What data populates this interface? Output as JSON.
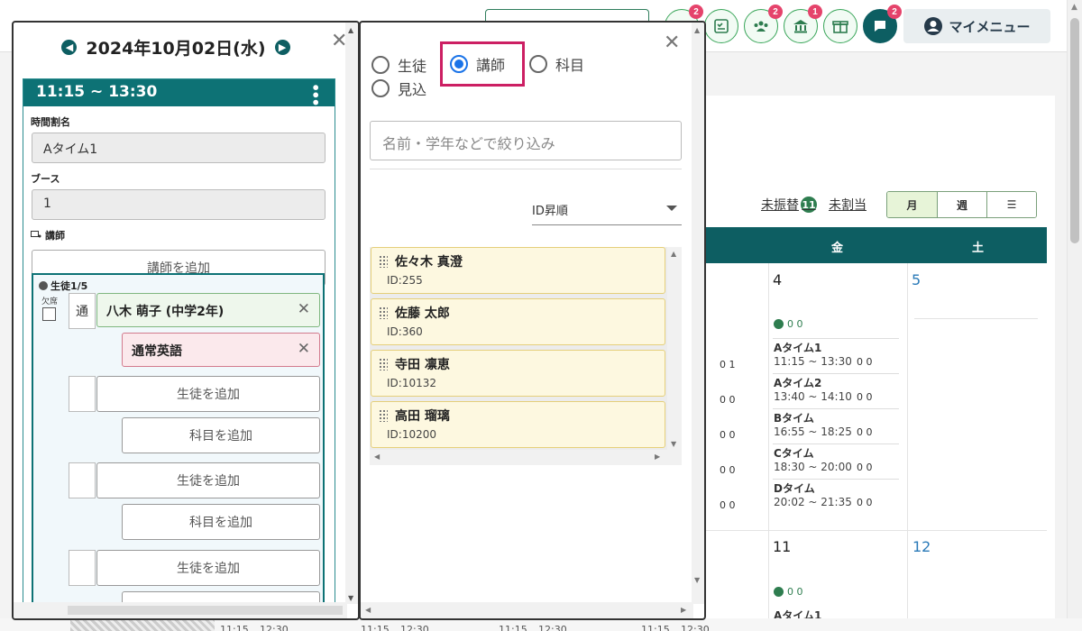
{
  "header": {
    "badges": [
      "2",
      "2",
      "1",
      "2"
    ],
    "my_menu_label": "マイメニュー"
  },
  "calendar": {
    "unassigned_label": "未振替",
    "unassigned_count": "11",
    "unallocated_label": "未割当",
    "view_buttons": [
      "月",
      "週",
      "☰"
    ],
    "weekday_fri": "金",
    "weekday_sat": "土",
    "day_4": "4",
    "day_5": "5",
    "day_11": "11",
    "day_12": "12",
    "day_counts": "0   0",
    "slots": [
      {
        "name": "Aタイム1",
        "time": "11:15 ~ 13:30",
        "counts": "0  0"
      },
      {
        "name": "Aタイム2",
        "time": "13:40 ~ 14:10",
        "counts": "0  0"
      },
      {
        "name": "Bタイム",
        "time": "16:55 ~ 18:25",
        "counts": "0  0"
      },
      {
        "name": "Cタイム",
        "time": "18:30 ~ 20:00",
        "counts": "0  0"
      },
      {
        "name": "Dタイム",
        "time": "20:02 ~ 21:35",
        "counts": "0  0"
      }
    ],
    "left_counts": [
      "0  1",
      "0  0",
      "0  0",
      "0  0",
      "0  0"
    ],
    "next_week_slot": "Aタイム1",
    "bottom_times": [
      "11:15",
      "12:30",
      "11:15",
      "12:30",
      "11:15",
      "12:30",
      "11:15",
      "12:30"
    ]
  },
  "session_panel": {
    "date": "2024年10月02日(水)",
    "time_range": "11:15 ~ 13:30",
    "timetable_label": "時間割名",
    "timetable_value": "Aタイム1",
    "booth_label": "ブース",
    "booth_value": "1",
    "teacher_label": "講師",
    "add_teacher": "講師を追加",
    "students_title": "生徒1/5",
    "absent_label": "欠席",
    "type_value": "通",
    "student_name": "八木 萌子 (中学2年)",
    "subject_name": "通常英語",
    "add_student": "生徒を追加",
    "add_subject": "科目を追加"
  },
  "picker_panel": {
    "radio_student": "生徒",
    "radio_teacher": "講師",
    "radio_subject": "科目",
    "radio_prospect": "見込",
    "selected": "講師",
    "search_placeholder": "名前・学年などで絞り込み",
    "sort_value": "ID昇順",
    "teachers": [
      {
        "name": "佐々木 真澄",
        "id": "ID:255"
      },
      {
        "name": "佐藤 太郎",
        "id": "ID:360"
      },
      {
        "name": "寺田 凛恵",
        "id": "ID:10132"
      },
      {
        "name": "高田 瑠璃",
        "id": "ID:10200"
      }
    ]
  },
  "colors": {
    "teal": "#0d5e62",
    "accent_green": "#3aa65a",
    "badge_pink": "#e5436b",
    "highlight": "#cc1f63"
  }
}
